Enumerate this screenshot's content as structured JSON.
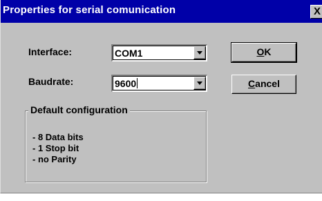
{
  "window": {
    "title": "Properties for serial comunication",
    "close_label": "X"
  },
  "form": {
    "interface_label": "Interface:",
    "interface_value": "COM1",
    "baudrate_label": "Baudrate:",
    "baudrate_value": "9600"
  },
  "buttons": {
    "ok_label": "OK",
    "ok_mnemonic": "O",
    "ok_rest": "K",
    "cancel_mnemonic": "C",
    "cancel_rest": "ancel"
  },
  "group": {
    "title": "Default configuration",
    "lines": [
      "- 8 Data bits",
      "- 1 Stop bit",
      "- no Parity"
    ]
  },
  "colors": {
    "face": "#c0c0c0",
    "titlebar": "#0000a8"
  },
  "icons": {
    "close": "close-icon",
    "dropdown": "triangle-down-icon"
  }
}
